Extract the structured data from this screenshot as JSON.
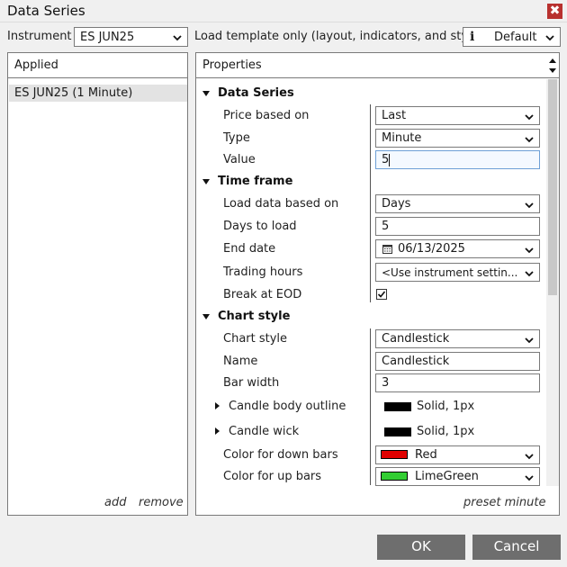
{
  "window": {
    "title": "Data Series",
    "close_glyph": "✖"
  },
  "toolbar": {
    "instrument_label": "Instrument",
    "instrument_value": "ES JUN25",
    "template_label": "Load template only (layout, indicators, and style)",
    "template_icon": "info-icon",
    "template_value": "Default"
  },
  "applied": {
    "header": "Applied",
    "items": [
      "ES JUN25 (1 Minute)"
    ],
    "add_label": "add",
    "remove_label": "remove"
  },
  "properties": {
    "header": "Properties",
    "footer_link": "preset minute",
    "sections": {
      "data_series": {
        "title": "Data Series",
        "price_based_on": {
          "label": "Price based on",
          "value": "Last"
        },
        "type": {
          "label": "Type",
          "value": "Minute"
        },
        "value": {
          "label": "Value",
          "value": "5"
        }
      },
      "time_frame": {
        "title": "Time frame",
        "load_data_based_on": {
          "label": "Load data based on",
          "value": "Days"
        },
        "days_to_load": {
          "label": "Days to load",
          "value": "5"
        },
        "end_date": {
          "label": "End date",
          "value": "06/13/2025"
        },
        "trading_hours": {
          "label": "Trading hours",
          "value": "<Use instrument settin..."
        },
        "break_at_eod": {
          "label": "Break at EOD",
          "checked": true
        }
      },
      "chart_style": {
        "title": "Chart style",
        "chart_style": {
          "label": "Chart style",
          "value": "Candlestick"
        },
        "name": {
          "label": "Name",
          "value": "Candlestick"
        },
        "bar_width": {
          "label": "Bar width",
          "value": "3"
        },
        "candle_body_outline": {
          "label": "Candle body outline",
          "value": "Solid, 1px",
          "color": "#000000"
        },
        "candle_wick": {
          "label": "Candle wick",
          "value": "Solid, 1px",
          "color": "#000000"
        },
        "color_down": {
          "label": "Color for down bars",
          "value": "Red",
          "color": "#e00000"
        },
        "color_up": {
          "label": "Color for up bars",
          "value": "LimeGreen",
          "color": "#32cd32"
        }
      }
    }
  },
  "buttons": {
    "ok": "OK",
    "cancel": "Cancel"
  },
  "colors": {
    "button_bg": "#6e6e6e",
    "close_bg": "#b8312f",
    "selection_bg": "#e3e3e3"
  }
}
